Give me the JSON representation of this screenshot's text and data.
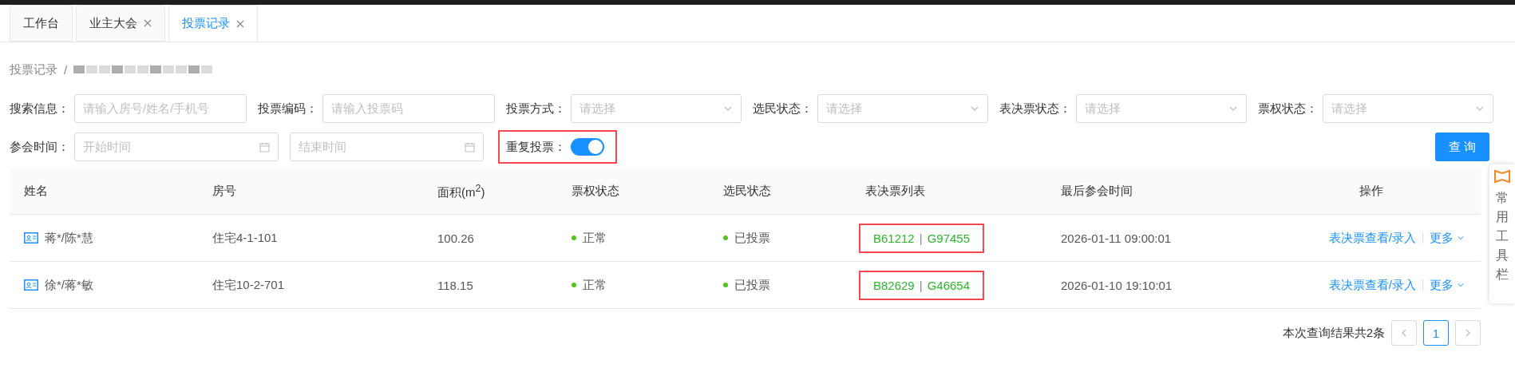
{
  "tabs": [
    {
      "label": "工作台",
      "closable": false,
      "selected": false
    },
    {
      "label": "业主大会",
      "closable": true,
      "selected": false
    },
    {
      "label": "投票记录",
      "closable": true,
      "selected": true
    }
  ],
  "breadcrumb": {
    "current": "投票记录",
    "separator": "/"
  },
  "filters": [
    {
      "kind": "text",
      "label": "搜索信息：",
      "placeholder": "请输入房号/姓名/手机号"
    },
    {
      "kind": "text",
      "label": "投票编码：",
      "placeholder": "请输入投票码"
    },
    {
      "kind": "select",
      "label": "投票方式：",
      "placeholder": "请选择"
    },
    {
      "kind": "select",
      "label": "选民状态：",
      "placeholder": "请选择"
    },
    {
      "kind": "select",
      "label": "表决票状态：",
      "placeholder": "请选择"
    },
    {
      "kind": "select",
      "label": "票权状态：",
      "placeholder": "请选择"
    },
    {
      "kind": "date-range",
      "label": "参会时间：",
      "start_placeholder": "开始时间",
      "end_placeholder": "结束时间"
    },
    {
      "kind": "switch",
      "label": "重复投票：",
      "on": true,
      "highlighted": true
    }
  ],
  "query_button": "查 询",
  "table": {
    "columns": [
      "姓名",
      "房号",
      "面积(m$^{2}$)",
      "票权状态",
      "选民状态",
      "表决票列表",
      "最后参会时间",
      "操作"
    ],
    "rows": [
      {
        "name": "蒋*/陈*慧",
        "room": "住宅4-1-101",
        "area": "100.26",
        "right_status": {
          "text": "正常",
          "color": "#52c41a"
        },
        "voter_status": {
          "text": "已投票",
          "color": "#52c41a"
        },
        "tickets": [
          "B61212",
          "G97455"
        ],
        "ticket_separator": "|",
        "highlighted": true,
        "last_time": "2026-01-11 09:00:01",
        "actions": [
          "表决票查看/录入",
          "更多"
        ]
      },
      {
        "name": "徐*/蒋*敏",
        "room": "住宅10-2-701",
        "area": "118.15",
        "right_status": {
          "text": "正常",
          "color": "#52c41a"
        },
        "voter_status": {
          "text": "已投票",
          "color": "#52c41a"
        },
        "tickets": [
          "B82629",
          "G46654"
        ],
        "ticket_separator": "|",
        "highlighted": true,
        "last_time": "2026-01-10 19:10:01",
        "actions": [
          "表决票查看/录入",
          "更多"
        ]
      }
    ]
  },
  "pagination": {
    "summary": "本次查询结果共2条",
    "pages": [
      {
        "label": "1",
        "selected": true
      }
    ]
  },
  "side_toolbar": {
    "label": "常用工具栏"
  }
}
